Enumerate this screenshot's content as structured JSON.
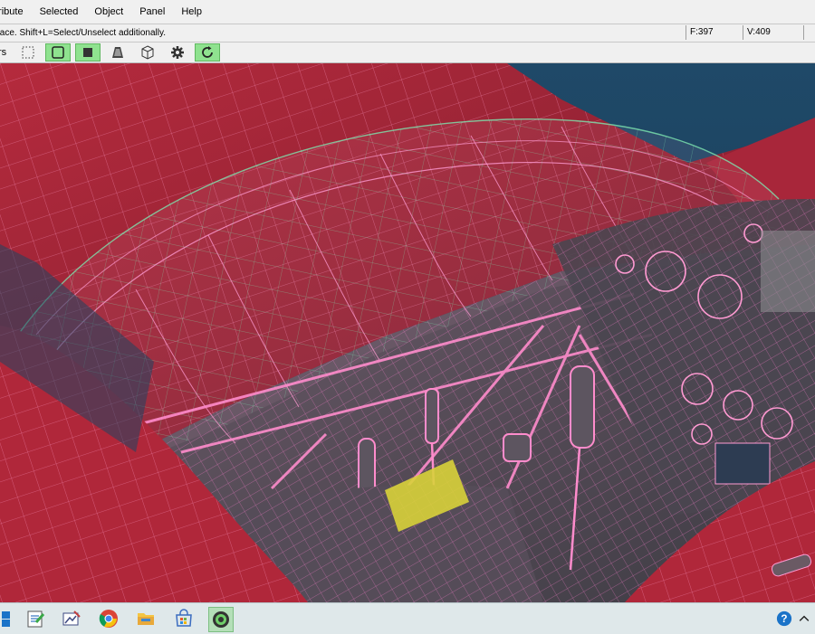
{
  "menu": {
    "items": [
      "tribute",
      "Selected",
      "Object",
      "Panel",
      "Help"
    ]
  },
  "status": {
    "hint": "face.  Shift+L=Select/Unselect additionally.",
    "faces": "F:397",
    "vertices": "V:409"
  },
  "toolbar": {
    "label": "rs",
    "buttons": [
      {
        "icon": "dotted-square-icon",
        "active": false
      },
      {
        "icon": "wire-frame-square-icon",
        "active": true
      },
      {
        "icon": "solid-square-icon",
        "active": true
      },
      {
        "icon": "shaded-cone-icon",
        "active": false
      },
      {
        "icon": "cube-icon",
        "active": false
      },
      {
        "icon": "gear-icon",
        "active": false
      },
      {
        "icon": "refresh-icon",
        "active": true
      }
    ]
  },
  "taskbar": {
    "apps": [
      "windows-start-icon",
      "notepad-icon",
      "paint-icon",
      "chrome-icon",
      "file-explorer-icon",
      "store-icon",
      "metasequoia-icon"
    ],
    "tray": [
      "help-icon",
      "chevron-up-icon"
    ]
  },
  "colors": {
    "wing_red": "#b0273a",
    "wire_pink": "#ff7fd0",
    "wire_green": "#7de6b0",
    "background_blue": "#1e4562",
    "selection_yellow": "#d8d23a",
    "active_button": "#8fe28f"
  }
}
